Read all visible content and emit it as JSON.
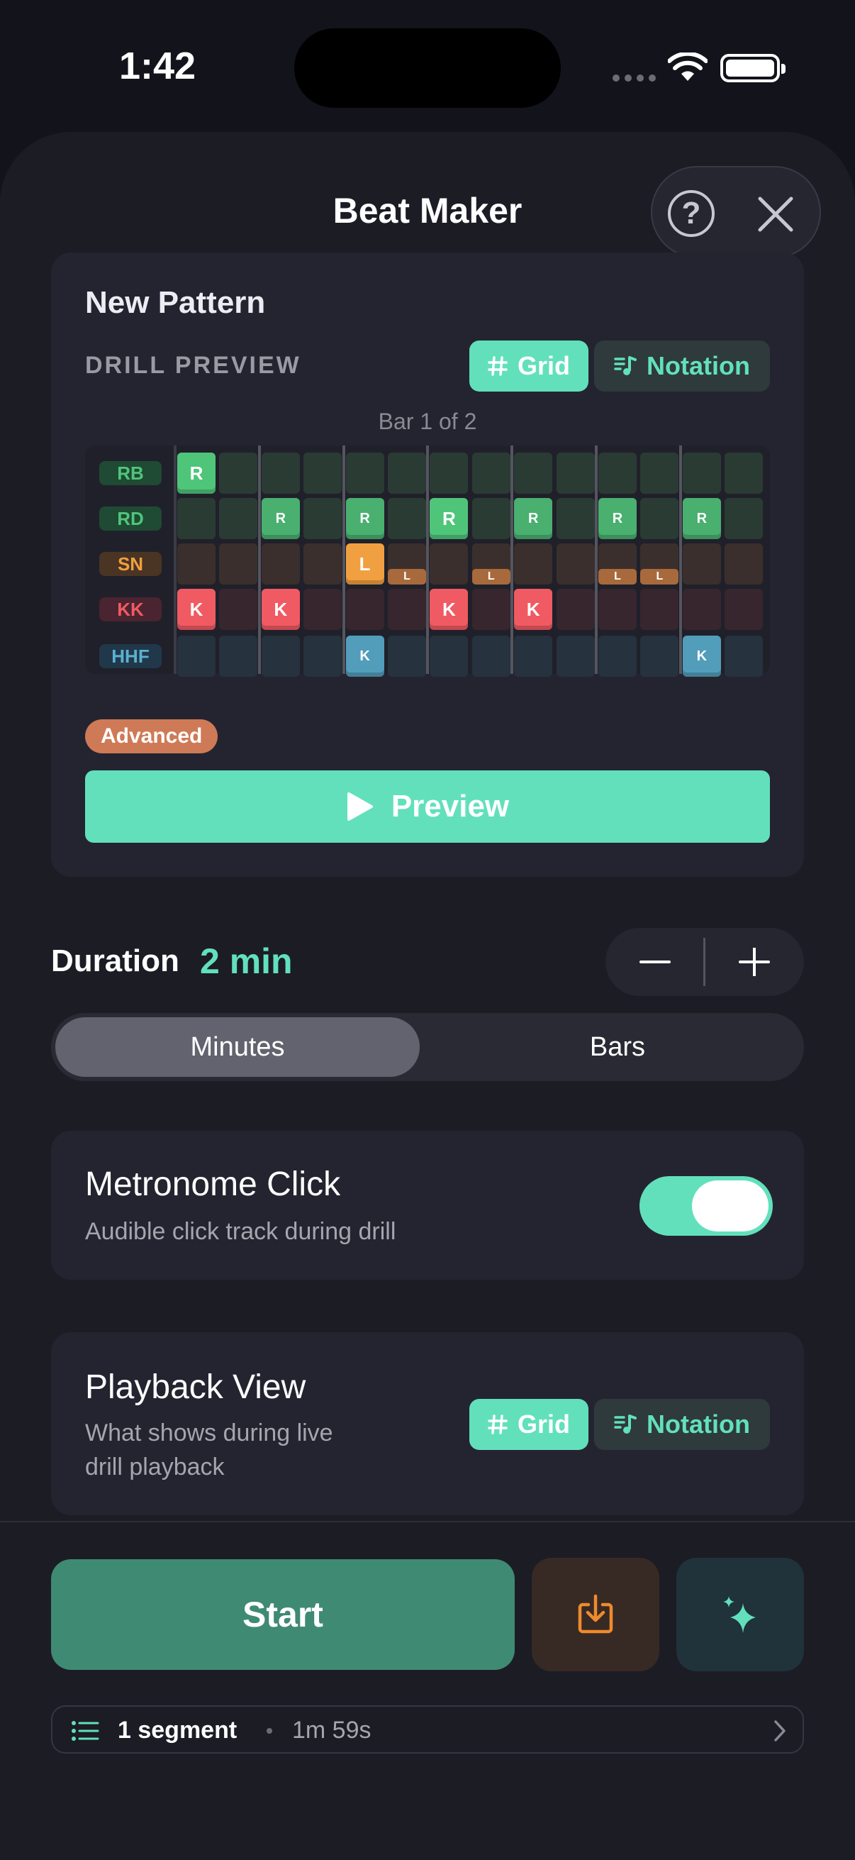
{
  "status": {
    "time": "1:42"
  },
  "header": {
    "title": "Beat Maker",
    "help_glyph": "?"
  },
  "preview_card": {
    "pattern_name": "New Pattern",
    "section_label": "DRILL PREVIEW",
    "view_toggle": {
      "grid_label": "Grid",
      "notation_label": "Notation",
      "selected": "Grid"
    },
    "bar_label": "Bar 1 of 2",
    "rows": [
      {
        "label": "RB",
        "color": "#4fc57a",
        "label_bg": "#1f4a34",
        "cell_bg": "#2a3b34",
        "hits": [
          {
            "step": 0,
            "text": "R",
            "accent": true
          }
        ]
      },
      {
        "label": "RD",
        "color": "#4fc57a",
        "label_bg": "#1f4a34",
        "cell_bg": "#2a3b34",
        "hits": [
          {
            "step": 2,
            "text": "R",
            "accent": false
          },
          {
            "step": 4,
            "text": "R",
            "accent": false
          },
          {
            "step": 6,
            "text": "R",
            "accent": true
          },
          {
            "step": 8,
            "text": "R",
            "accent": false
          },
          {
            "step": 10,
            "text": "R",
            "accent": false
          },
          {
            "step": 12,
            "text": "R",
            "accent": false
          }
        ]
      },
      {
        "label": "SN",
        "color": "#f0a040",
        "label_bg": "#4a3424",
        "cell_bg": "#3a2f2c",
        "hits": [
          {
            "step": 4,
            "text": "L",
            "accent": true
          }
        ],
        "ghosts": [
          {
            "step": 5,
            "text": "L"
          },
          {
            "step": 7,
            "text": "L"
          },
          {
            "step": 10,
            "text": "L"
          },
          {
            "step": 11,
            "text": "L"
          }
        ]
      },
      {
        "label": "KK",
        "color": "#f05a62",
        "label_bg": "#4a2430",
        "cell_bg": "#37262e",
        "hits": [
          {
            "step": 0,
            "text": "K",
            "accent": true
          },
          {
            "step": 2,
            "text": "K",
            "accent": true
          },
          {
            "step": 6,
            "text": "K",
            "accent": true
          },
          {
            "step": 8,
            "text": "K",
            "accent": true
          }
        ]
      },
      {
        "label": "HHF",
        "color": "#5bb0d0",
        "label_bg": "#20384a",
        "cell_bg": "#26323e",
        "hits": [
          {
            "step": 4,
            "text": "K",
            "accent": false
          },
          {
            "step": 12,
            "text": "K",
            "accent": false
          }
        ]
      }
    ],
    "difficulty_badge": "Advanced",
    "preview_button": "Preview"
  },
  "duration": {
    "label": "Duration",
    "value": "2 min",
    "units": [
      "Minutes",
      "Bars"
    ],
    "selected_unit": "Minutes"
  },
  "metronome": {
    "title": "Metronome Click",
    "subtitle": "Audible click track during drill",
    "enabled": true
  },
  "playback_view": {
    "title": "Playback View",
    "subtitle_line1": "What shows during live",
    "subtitle_line2": "drill playback",
    "grid_label": "Grid",
    "notation_label": "Notation",
    "selected": "Grid"
  },
  "footer": {
    "start_label": "Start",
    "segments": "1 segment",
    "total_time": "1m 59s"
  },
  "colors": {
    "accent": "#62e0bc",
    "start": "#3f8a73",
    "import_icon": "#f08a2c"
  },
  "icons": [
    "help-icon",
    "close-icon",
    "grid-hash-icon",
    "music-note-icon",
    "play-icon",
    "minus-icon",
    "plus-icon",
    "import-icon",
    "sparkle-icon",
    "list-icon",
    "chevron-right-icon"
  ]
}
